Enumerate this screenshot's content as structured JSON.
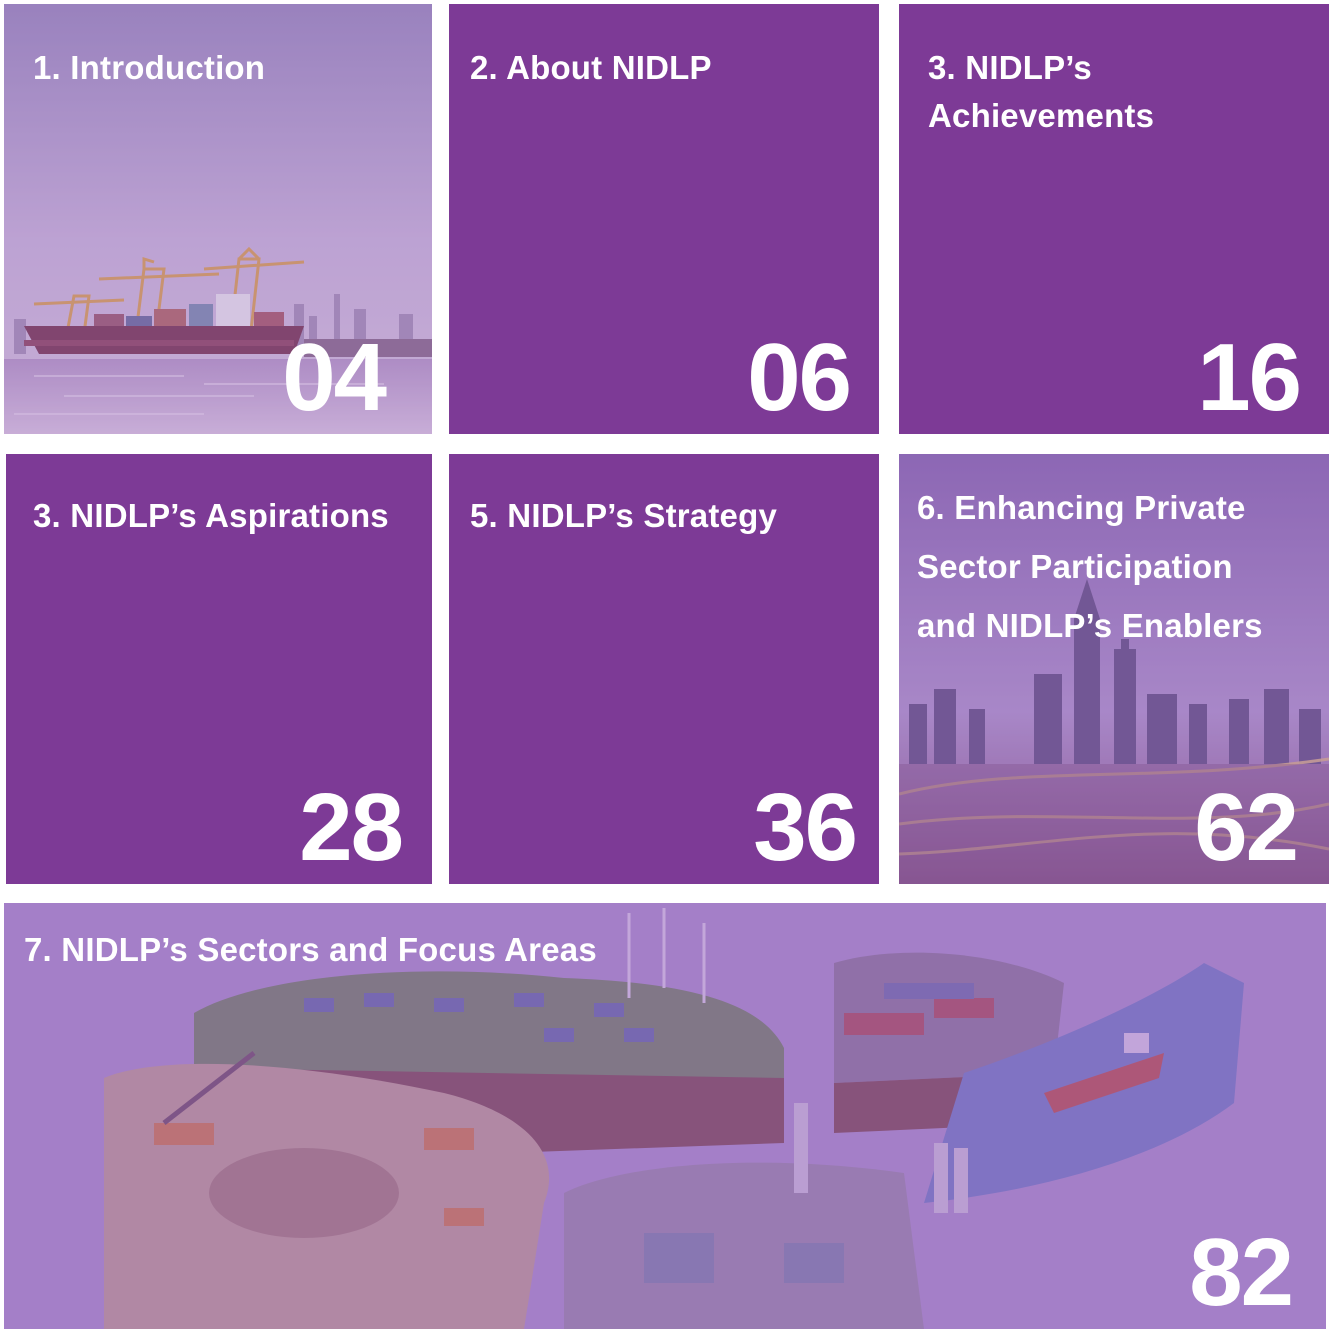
{
  "tiles": [
    {
      "title": "1. Introduction",
      "page": "04"
    },
    {
      "title": "2. About NIDLP",
      "page": "06"
    },
    {
      "title": "3. NIDLP’s Achievements",
      "title_lines": [
        "3. NIDLP’s",
        "Achievements"
      ],
      "page": "16"
    },
    {
      "title": "3. NIDLP’s Aspirations",
      "page": "28"
    },
    {
      "title": "5. NIDLP’s Strategy",
      "page": "36"
    },
    {
      "title": "6. Enhancing Private Sector Participation and NIDLP’s Enablers",
      "title_lines": [
        "6. Enhancing Private",
        "Sector Participation",
        "and NIDLP’s Enablers"
      ],
      "page": "62"
    },
    {
      "title": "7. NIDLP’s Sectors and Focus Areas",
      "page": "82"
    }
  ],
  "colors": {
    "accent_purple": "#7d3a96",
    "text": "#ffffff",
    "background": "#ffffff"
  }
}
